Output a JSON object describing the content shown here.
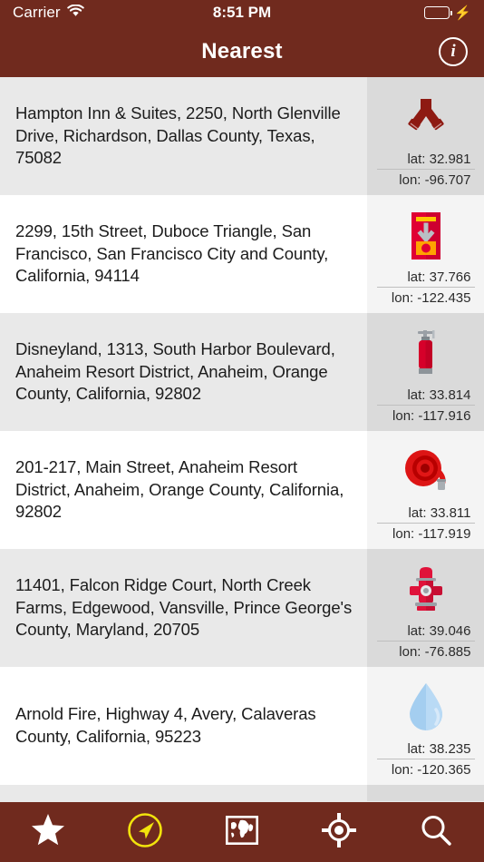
{
  "status_bar": {
    "carrier": "Carrier",
    "wifi_icon": "wifi-icon",
    "time": "8:51 PM",
    "battery_icon": "battery-icon",
    "charging_icon": "lightning-bolt-icon"
  },
  "nav_bar": {
    "title": "Nearest",
    "info_label": "i",
    "info_icon": "info-circle-icon",
    "background_color": "#702A1E"
  },
  "list": {
    "lat_prefix": "lat: ",
    "lon_prefix": "lon: ",
    "rows": [
      {
        "address": "Hampton Inn & Suites, 2250, North Glenville Drive, Richardson, Dallas County, Texas, 75082",
        "lat": "lat: 32.981",
        "lon": "lon: -96.707",
        "icon": "fire-hose-connection-icon",
        "icon_color": "#8E1A12"
      },
      {
        "address": "2299, 15th Street, Duboce Triangle, San Francisco, San Francisco City and County, California, 94114",
        "lat": "lat: 37.766",
        "lon": "lon: -122.435",
        "icon": "fire-alarm-callbox-icon",
        "icon_color": "#E00034"
      },
      {
        "address": "Disneyland, 1313, South Harbor Boulevard, Anaheim Resort District, Anaheim, Orange County, California, 92802",
        "lat": "lat: 33.814",
        "lon": "lon: -117.916",
        "icon": "fire-extinguisher-icon",
        "icon_color": "#D6002A"
      },
      {
        "address": "201-217, Main Street, Anaheim Resort District, Anaheim, Orange County, California, 92802",
        "lat": "lat: 33.811",
        "lon": "lon: -117.919",
        "icon": "fire-hose-reel-icon",
        "icon_color": "#DD1515"
      },
      {
        "address": "11401, Falcon Ridge Court, North Creek Farms, Edgewood, Vansville, Prince George's County, Maryland, 20705",
        "lat": "lat: 39.046",
        "lon": "lon: -76.885",
        "icon": "fire-hydrant-icon",
        "icon_color": "#E0123A"
      },
      {
        "address": "Arnold Fire, Highway 4, Avery, Calaveras County, California, 95223",
        "lat": "lat: 38.235",
        "lon": "lon: -120.365",
        "icon": "water-drop-icon",
        "icon_color": "#8FC6F0"
      }
    ]
  },
  "tab_bar": {
    "background_color": "#702A1E",
    "active_color": "#F2E30C",
    "tabs": [
      {
        "name": "favorites",
        "icon": "star-icon",
        "active": false
      },
      {
        "name": "nearest",
        "icon": "navigation-arrow-icon",
        "active": true
      },
      {
        "name": "map",
        "icon": "world-map-icon",
        "active": false
      },
      {
        "name": "locate",
        "icon": "crosshair-location-icon",
        "active": false
      },
      {
        "name": "search",
        "icon": "magnifier-icon",
        "active": false
      }
    ]
  }
}
